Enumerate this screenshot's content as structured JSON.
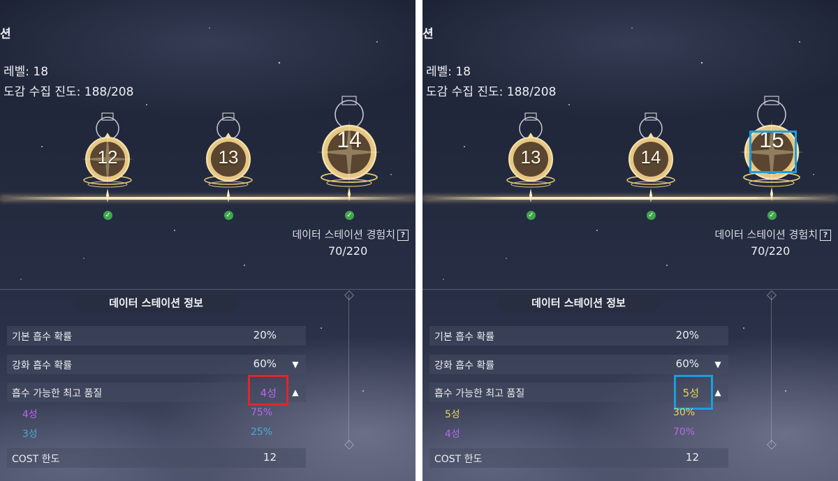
{
  "panels": [
    {
      "title_fragment": "션",
      "level_text": "레벨: 18",
      "progress_text": "도감 수집 진도: 188/208",
      "nodes": [
        "12",
        "13",
        "14"
      ],
      "exp_label": "데이터 스테이션 경험치",
      "exp_help_icon": "?",
      "exp_value": "70/220",
      "section_title": "데이터 스테이션 정보",
      "rows": [
        {
          "label": "기본 흡수 확률",
          "value": "20%"
        },
        {
          "label": "강화 흡수 확률",
          "value": "60%",
          "chevron": "down-chevron-icon"
        },
        {
          "label": "흡수 가능한 최고 품질",
          "value": "4성",
          "chevron": "up-chevron-icon",
          "value_color": "#b967ea"
        }
      ],
      "sub_rows": [
        {
          "label": "4성",
          "value": "75%",
          "color": "#b967ea"
        },
        {
          "label": "3성",
          "value": "25%",
          "color": "#4aa8d2"
        }
      ],
      "cost_label": "COST 한도",
      "cost_value": "12",
      "highlight_color": "#e0262a"
    },
    {
      "title_fragment": "션",
      "level_text": "레벨: 18",
      "progress_text": "도감 수집 진도: 188/208",
      "nodes": [
        "13",
        "14",
        "15"
      ],
      "exp_label": "데이터 스테이션 경험치",
      "exp_help_icon": "?",
      "exp_value": "70/220",
      "section_title": "데이터 스테이션 정보",
      "rows": [
        {
          "label": "기본 흡수 확률",
          "value": "20%"
        },
        {
          "label": "강화 흡수 확률",
          "value": "60%",
          "chevron": "down-chevron-icon"
        },
        {
          "label": "흡수 가능한 최고 품질",
          "value": "5성",
          "chevron": "up-chevron-icon",
          "value_color": "#e8d65a"
        }
      ],
      "sub_rows": [
        {
          "label": "5성",
          "value": "30%",
          "color": "#e8d65a"
        },
        {
          "label": "4성",
          "value": "70%",
          "color": "#b967ea"
        }
      ],
      "cost_label": "COST 한도",
      "cost_value": "12",
      "highlight_color": "#1a9ee0"
    }
  ]
}
